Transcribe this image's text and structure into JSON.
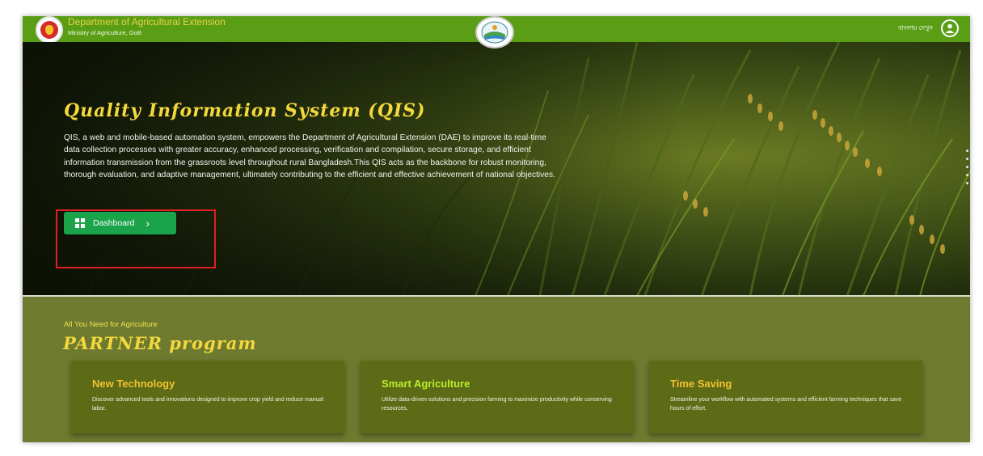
{
  "header": {
    "org_name": "Department of Agricultural Extension",
    "org_sub": "Ministry of Agriculture, GoB",
    "language_toggle": "বাংলায় দেখুন",
    "logo_icon": "government-seal-icon",
    "center_emblem_icon": "qis-emblem-icon",
    "user_icon": "user-circle-icon"
  },
  "hero": {
    "title": "Quality Information System (QIS)",
    "description": "QIS, a web and mobile-based automation system, empowers the Department of Agricultural Extension (DAE) to improve its real-time data collection processes with greater accuracy, enhanced processing, verification and compilation, secure storage, and efficient information transmission from the grassroots level throughout rural Bangladesh.This QIS acts as the backbone for robust monitoring, thorough evaluation, and adaptive management, ultimately contributing to the efficient and effective achievement of national objectives.",
    "dashboard_label": "Dashboard",
    "dashboard_icon": "dashboard-grid-icon",
    "chevron_icon": "chevron-right-icon"
  },
  "partner": {
    "kicker": "All You Need for Agriculture",
    "title": "PARTNER program",
    "cards": [
      {
        "title": "New Technology",
        "desc": "Discover advanced tools and innovations designed to improve crop yield and reduce manual labor."
      },
      {
        "title": "Smart Agriculture",
        "desc": "Utilize data-driven solutions and precision farming to maximize productivity while conserving resources."
      },
      {
        "title": "Time Saving",
        "desc": "Streamline your workflow with automated systems and efficient farming techniques that save hours of effort."
      }
    ]
  },
  "colors": {
    "header_green": "#5a9e16",
    "title_yellow": "#f4d93c",
    "button_green": "#1aa34a",
    "section_olive": "#6d7a30",
    "card_olive": "#5e6b16",
    "highlight_red": "#e02020"
  }
}
